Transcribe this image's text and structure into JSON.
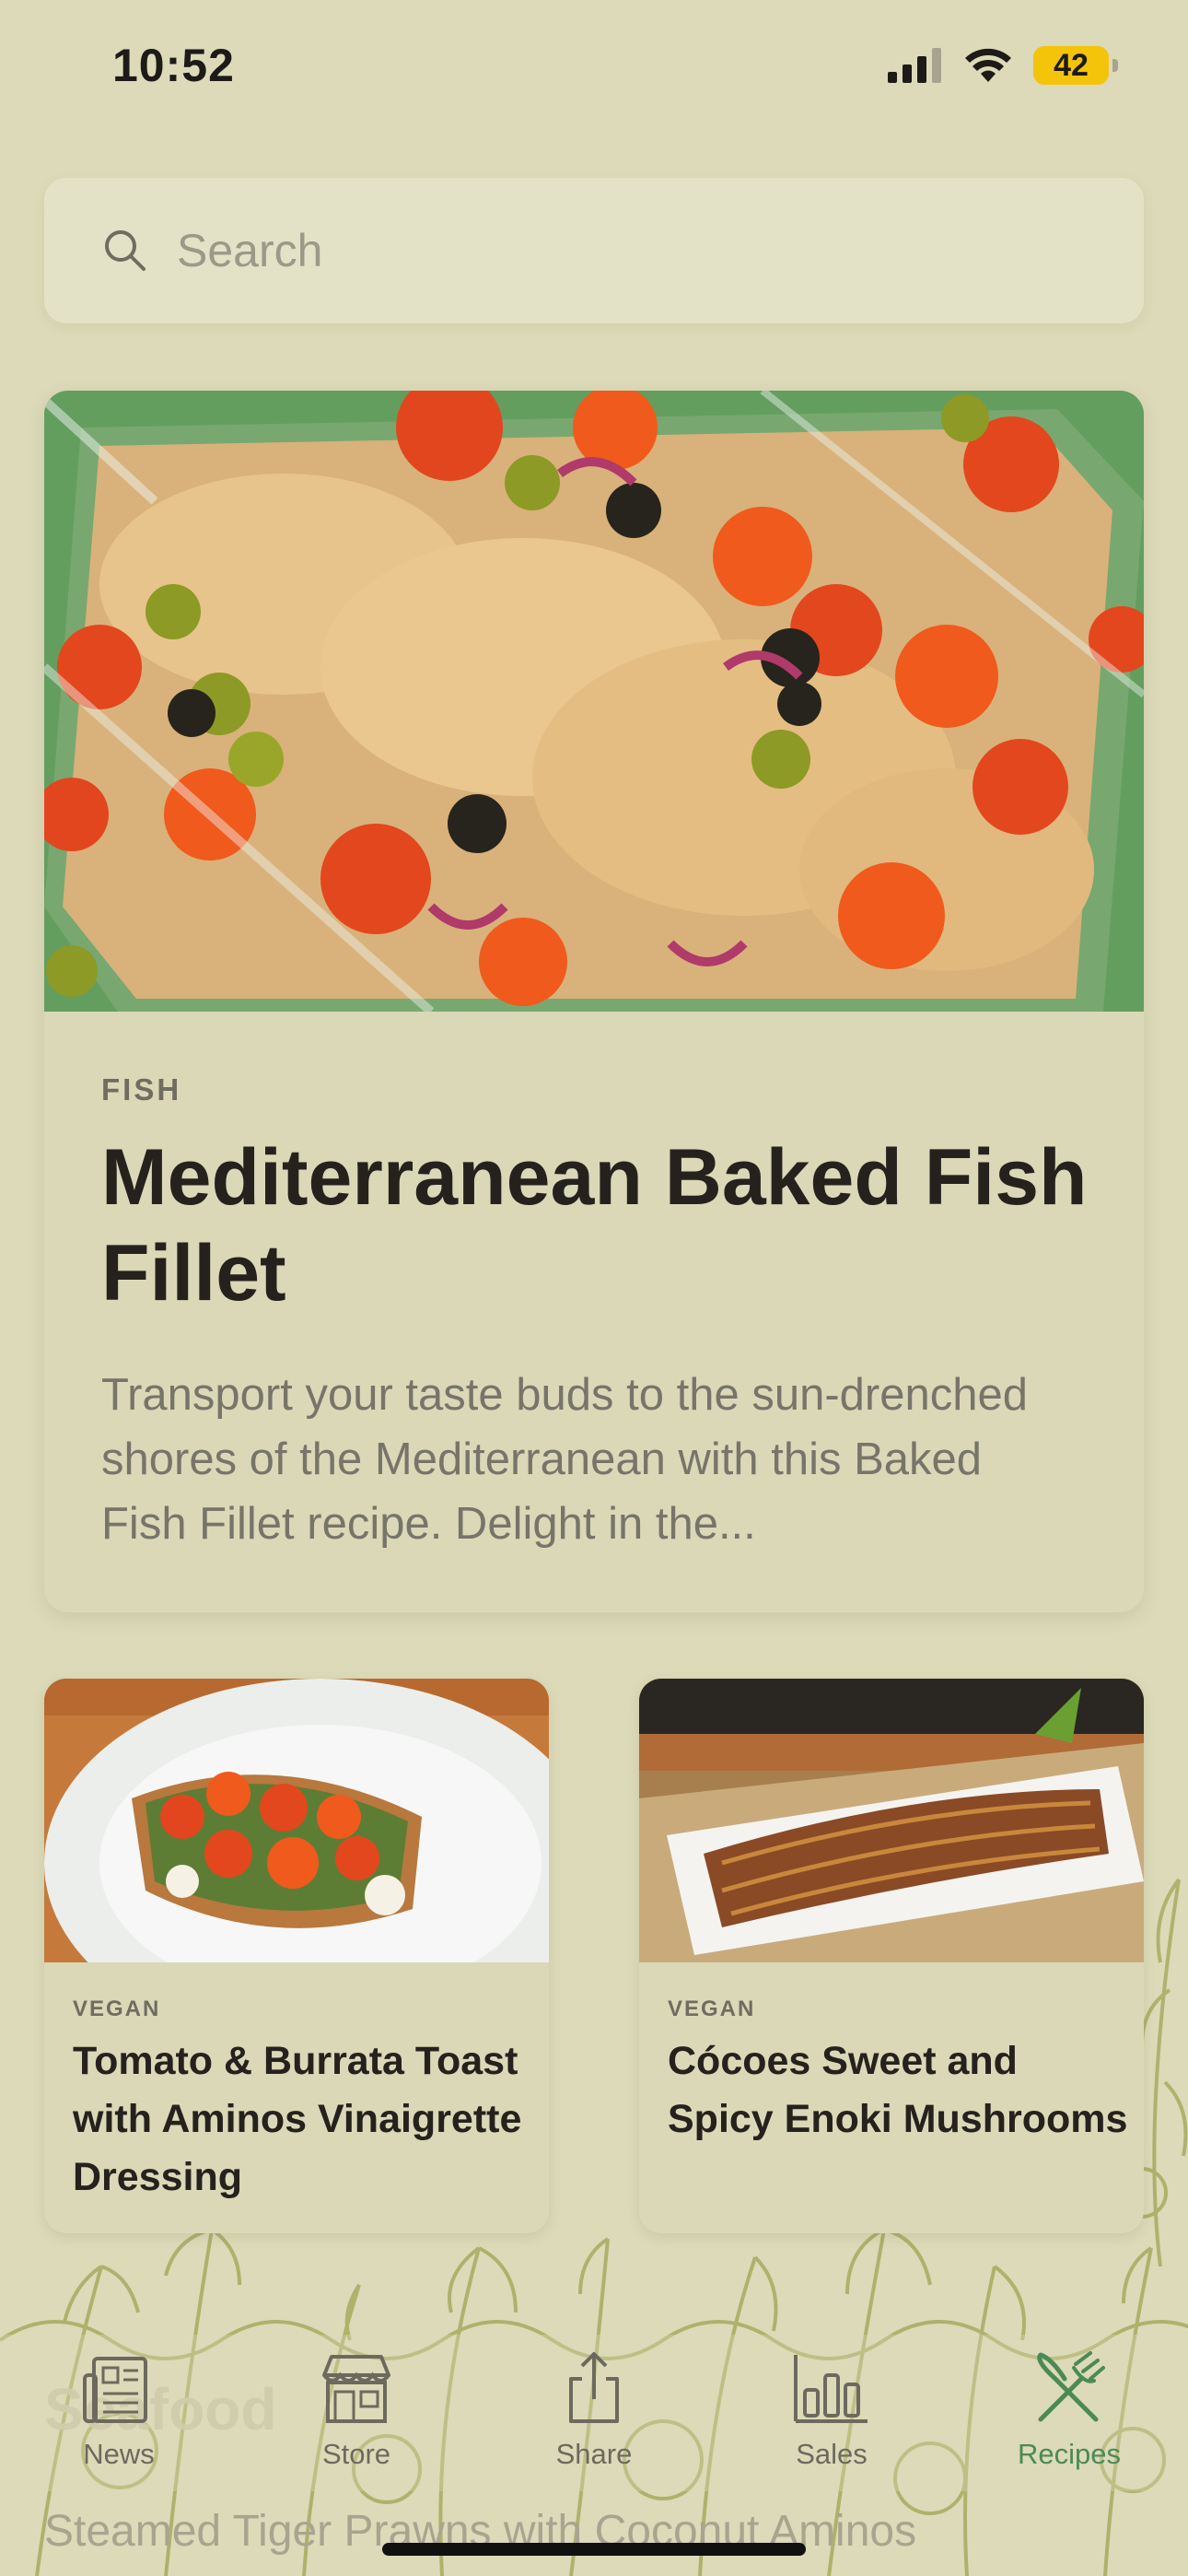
{
  "status": {
    "time": "10:52",
    "battery": "42"
  },
  "search": {
    "placeholder": "Search"
  },
  "featured": {
    "category": "FISH",
    "title": "Mediterranean Baked Fish Fillet",
    "description": "Transport your taste buds to the sun-drenched shores of the Mediterranean with this Baked Fish Fillet recipe. Delight in the..."
  },
  "cards": [
    {
      "category": "VEGAN",
      "title": "Tomato & Burrata Toast with Aminos Vinaigrette Dressing"
    },
    {
      "category": "VEGAN",
      "title": "Cócoes Sweet and Spicy Enoki Mushrooms"
    }
  ],
  "next_section": {
    "title": "Seafood",
    "first_item": "Steamed Tiger Prawns with Coconut Aminos"
  },
  "tabs": [
    {
      "label": "News",
      "icon": "newspaper-icon"
    },
    {
      "label": "Store",
      "icon": "store-icon"
    },
    {
      "label": "Share",
      "icon": "share-icon"
    },
    {
      "label": "Sales",
      "icon": "bar-chart-icon"
    },
    {
      "label": "Recipes",
      "icon": "fork-knife-icon",
      "active": true
    }
  ],
  "colors": {
    "background": "#dcdab8",
    "card": "#dad8b7",
    "accent": "#4b8a56",
    "battery": "#f4c40b"
  }
}
